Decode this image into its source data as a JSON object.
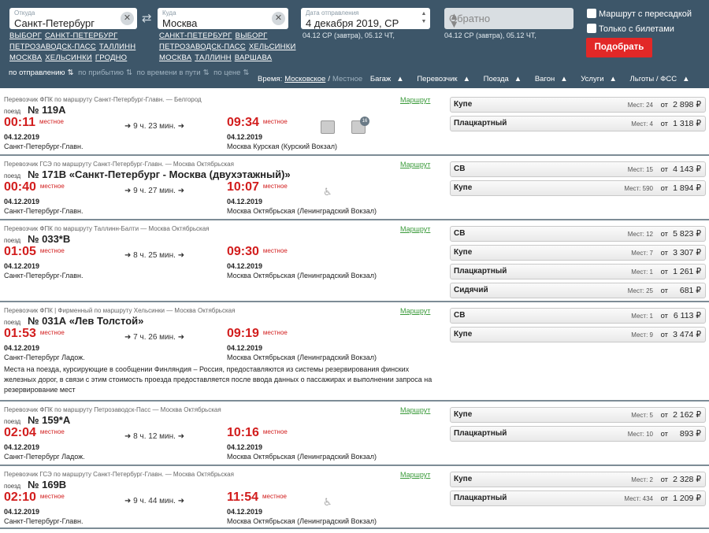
{
  "search": {
    "from_label": "Откуда",
    "from_value": "Санкт-Петербург",
    "to_label": "Куда",
    "to_value": "Москва",
    "date_label": "Дата отправления",
    "date_value": "4 декабря 2019, СР",
    "date_sub": "04.12 СР (завтра), 05.12 ЧТ,",
    "return_placeholder": "Обратно",
    "return_sub": "04.12 СР (завтра), 05.12 ЧТ,",
    "transfer_label": "Маршрут с пересадкой",
    "tickets_only_label": "Только с билетами",
    "search_button": "Подобрать",
    "from_links": [
      [
        "ВЫБОРГ",
        "САНКТ-ПЕТЕРБУРГ"
      ],
      [
        "ПЕТРОЗАВОДСК-ПАСС",
        "ТАЛЛИНН"
      ],
      [
        "МОСКВА",
        "ХЕЛЬСИНКИ",
        "ГРОДНО"
      ]
    ],
    "to_links": [
      [
        "САНКТ-ПЕТЕРБУРГ",
        "ВЫБОРГ"
      ],
      [
        "ПЕТРОЗАВОДСК-ПАСС",
        "ХЕЛЬСИНКИ"
      ],
      [
        "МОСКВА",
        "ТАЛЛИНН",
        "ВАРШАВА"
      ]
    ],
    "clear_icon": "✕",
    "swap_icon": "⇄"
  },
  "sort": {
    "by_departure": "по отправлению",
    "by_arrival": "по прибытию",
    "by_travel_time": "по времени в пути",
    "by_price": "по цене",
    "arrow_icon": "⇅"
  },
  "filters": {
    "time_label": "Время:",
    "time_moscow": "Московское",
    "time_sep": "/",
    "time_local": "Местное",
    "baggage": "Багаж",
    "carrier": "Перевозчик",
    "train": "Поезда",
    "car": "Вагон",
    "services": "Услуги",
    "benefits": "Льготы / ФСС",
    "arrow_icon": "▲"
  },
  "labels": {
    "poezd": "поезд",
    "local": "местное",
    "route": "Маршрут",
    "seats": "Мест:",
    "from": "от",
    "arrow_icon": "➜"
  },
  "trains": [
    {
      "carrier": "Перевозчик  ФПК   по маршруту Санкт-Петербург-Главн. — Белгород",
      "number": "№ 119А",
      "dep_time": "00:11",
      "duration": "9 ч. 23 мин.",
      "arr_time": "09:34",
      "dep_date": "04.12.2019",
      "arr_date": "04.12.2019",
      "dep_station": "Санкт-Петербург-Главн.",
      "arr_station": "Москва Курская (Курский Вокзал)",
      "amenity_badge": "16",
      "note": "",
      "fares": [
        {
          "class": "Купе",
          "seats": "24",
          "price": "2 898 ₽"
        },
        {
          "class": "Плацкартный",
          "seats": "4",
          "price": "1 318 ₽"
        }
      ]
    },
    {
      "carrier": "Перевозчик  ГСЭ   по маршруту Санкт-Петербург-Главн. — Москва Октябрьская",
      "number": "№ 171В «Санкт-Петербург - Москва (двухэтажный)»",
      "dep_time": "00:40",
      "duration": "9 ч. 27 мин.",
      "arr_time": "10:07",
      "dep_date": "04.12.2019",
      "arr_date": "04.12.2019",
      "dep_station": "Санкт-Петербург-Главн.",
      "arr_station": "Москва Октябрьская (Ленинградский Вокзал)",
      "note": "",
      "fares": [
        {
          "class": "СВ",
          "seats": "15",
          "price": "4 143 ₽"
        },
        {
          "class": "Купе",
          "seats": "590",
          "price": "1 894 ₽"
        }
      ]
    },
    {
      "carrier": "Перевозчик  ФПК   по маршруту Таллинн-Балти — Москва Октябрьская",
      "number": "№ 033*В",
      "dep_time": "01:05",
      "duration": "8 ч. 25 мин.",
      "arr_time": "09:30",
      "dep_date": "04.12.2019",
      "arr_date": "04.12.2019",
      "dep_station": "Санкт-Петербург-Главн.",
      "arr_station": "Москва Октябрьская (Ленинградский Вокзал)",
      "note": "",
      "fares": [
        {
          "class": "СВ",
          "seats": "12",
          "price": "5 823 ₽"
        },
        {
          "class": "Купе",
          "seats": "7",
          "price": "3 307 ₽"
        },
        {
          "class": "Плацкартный",
          "seats": "1",
          "price": "1 261 ₽"
        },
        {
          "class": "Сидячий",
          "seats": "25",
          "price": "681 ₽"
        }
      ]
    },
    {
      "carrier": "Перевозчик  ФПК | Фирменный   по маршруту Хельсинки — Москва Октябрьская",
      "number": "№ 031А «Лев Толстой»",
      "dep_time": "01:53",
      "duration": "7 ч. 26 мин.",
      "arr_time": "09:19",
      "dep_date": "04.12.2019",
      "arr_date": "04.12.2019",
      "dep_station": "Санкт-Петербург Ладож.",
      "arr_station": "Москва Октябрьская (Ленинградский Вокзал)",
      "note": "Места на поезда, курсирующие в сообщении Финляндия – Россия, предоставляются из системы резервирования финских железных дорог, в связи с этим стоимость проезда предоставляется после ввода данных о пассажирах и выполнении запроса на резервирование мест",
      "fares": [
        {
          "class": "СВ",
          "seats": "1",
          "price": "6 113 ₽"
        },
        {
          "class": "Купе",
          "seats": "9",
          "price": "3 474 ₽"
        }
      ]
    },
    {
      "carrier": "Перевозчик  ФПК   по маршруту Петрозаводск-Пасс — Москва Октябрьская",
      "number": "№ 159*А",
      "dep_time": "02:04",
      "duration": "8 ч. 12 мин.",
      "arr_time": "10:16",
      "dep_date": "04.12.2019",
      "arr_date": "04.12.2019",
      "dep_station": "Санкт-Петербург Ладож.",
      "arr_station": "Москва Октябрьская (Ленинградский Вокзал)",
      "note": "",
      "fares": [
        {
          "class": "Купе",
          "seats": "5",
          "price": "2 162 ₽"
        },
        {
          "class": "Плацкартный",
          "seats": "10",
          "price": "893 ₽"
        }
      ]
    },
    {
      "carrier": "Перевозчик  ГСЭ   по маршруту Санкт-Петербург-Главн. — Москва Октябрьская",
      "number": "№ 169В",
      "dep_time": "02:10",
      "duration": "9 ч. 44 мин.",
      "arr_time": "11:54",
      "dep_date": "04.12.2019",
      "arr_date": "04.12.2019",
      "dep_station": "Санкт-Петербург-Главн.",
      "arr_station": "Москва Октябрьская (Ленинградский Вокзал)",
      "note": "",
      "fares": [
        {
          "class": "Купе",
          "seats": "2",
          "price": "2 328 ₽"
        },
        {
          "class": "Плацкартный",
          "seats": "434",
          "price": "1 209 ₽"
        }
      ]
    }
  ]
}
